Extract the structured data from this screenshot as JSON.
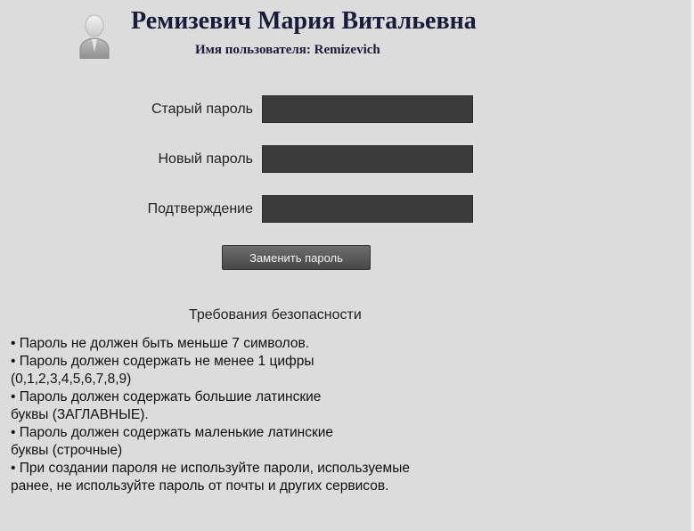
{
  "profile": {
    "full_name": "Ремизевич Мария Витальевна",
    "username_line": "Имя пользователя: Remizevich",
    "avatar_icon": "user-avatar-icon"
  },
  "form": {
    "old_password": {
      "label": "Старый пароль",
      "value": ""
    },
    "new_password": {
      "label": "Новый пароль",
      "value": ""
    },
    "confirm_password": {
      "label": "Подтверждение",
      "value": ""
    },
    "submit_label": "Заменить пароль"
  },
  "requirements": {
    "title": "Требования безопасности",
    "lines": [
      "• Пароль не должен быть меньше 7 символов.",
      "• Пароль должен содержать не менее 1 цифры",
      "(0,1,2,3,4,5,6,7,8,9)",
      "• Пароль должен содержать большие латинские",
      "буквы (ЗАГЛАВНЫЕ).",
      "• Пароль должен содержать маленькие латинские",
      "буквы (строчные)",
      "• При создании пароля не используйте пароли, используемые",
      "ранее, не используйте пароль от почты и других сервисов."
    ]
  },
  "colors": {
    "background": "#dcdcdc",
    "input_fill": "#3b3b3b",
    "button_fill": "#555555",
    "heading_text": "#1a1a3a"
  }
}
